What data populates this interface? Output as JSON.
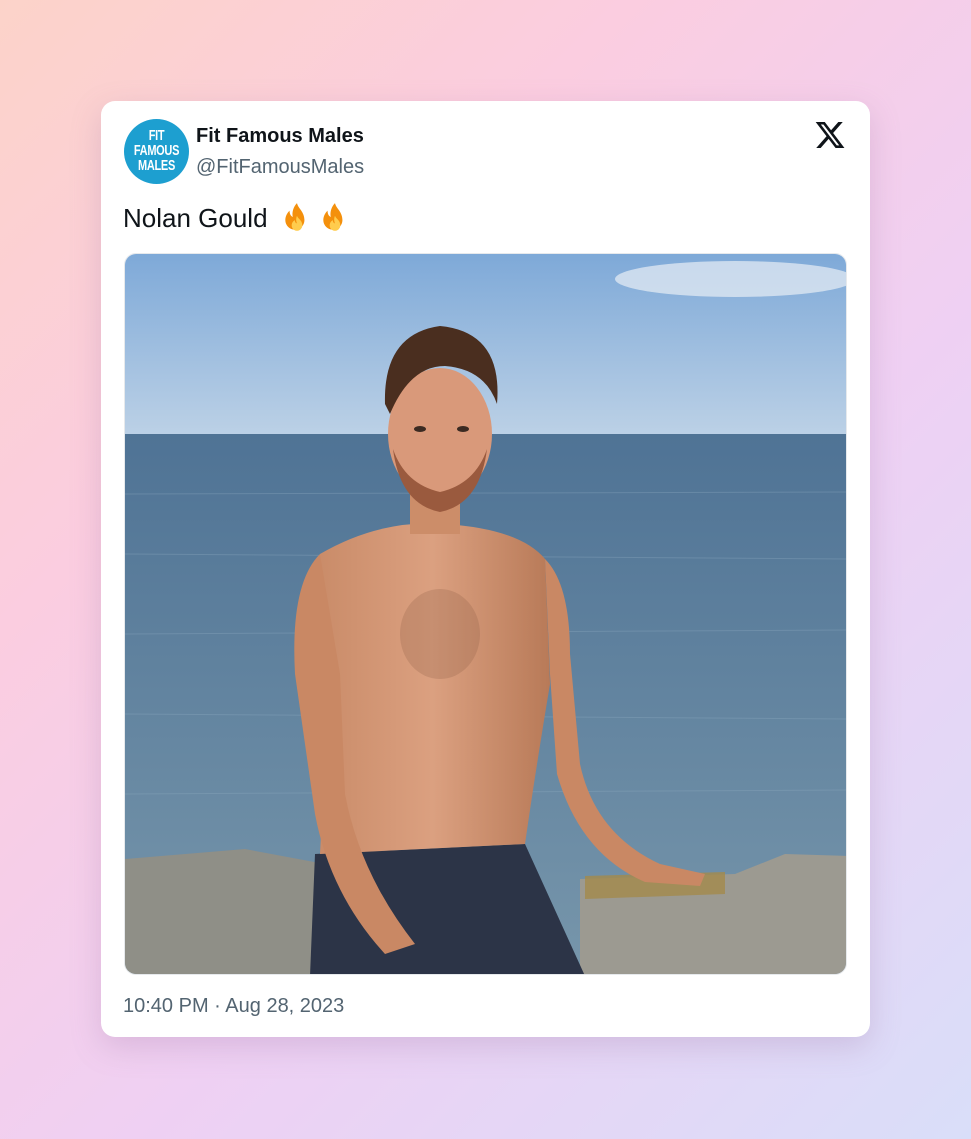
{
  "tweet": {
    "author": {
      "display_name": "Fit Famous Males",
      "handle": "@FitFamousMales",
      "avatar_lines": [
        "FIT",
        "FAMOUS",
        "MALES"
      ]
    },
    "text": "Nolan Gould",
    "emoji": [
      "fire-icon",
      "fire-icon"
    ],
    "time": "10:40 PM",
    "separator": "·",
    "date": "Aug 28, 2023",
    "platform_icon": "x-logo-icon"
  },
  "colors": {
    "avatar_bg": "#1d9fd0",
    "name": "#0f1419",
    "secondary": "#536471",
    "card": "#ffffff"
  }
}
